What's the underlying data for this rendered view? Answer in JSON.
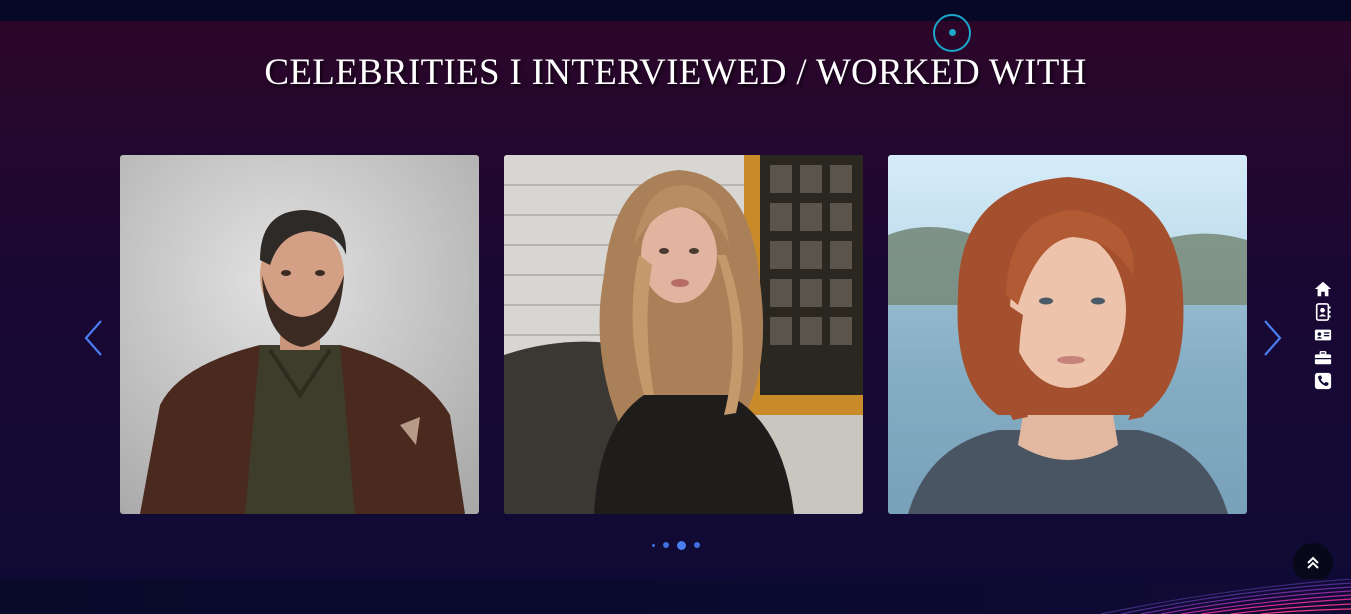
{
  "section": {
    "title": "CELEBRITIES I INTERVIEWED / WORKED WITH"
  },
  "carousel": {
    "cards": [
      {
        "name": "celebrity-man-brown-jacket"
      },
      {
        "name": "celebrity-woman-blonde-black-jacket"
      },
      {
        "name": "celebrity-woman-red-hair"
      }
    ],
    "dots": 4,
    "active_dot": 3
  },
  "sidenav": {
    "icons": [
      "home-icon",
      "contact-book-icon",
      "id-card-icon",
      "briefcase-icon",
      "phone-icon"
    ]
  },
  "colors": {
    "accent": "#4a7df0",
    "footer_accent": "#1aa7c9",
    "title_text": "#ffffff"
  }
}
